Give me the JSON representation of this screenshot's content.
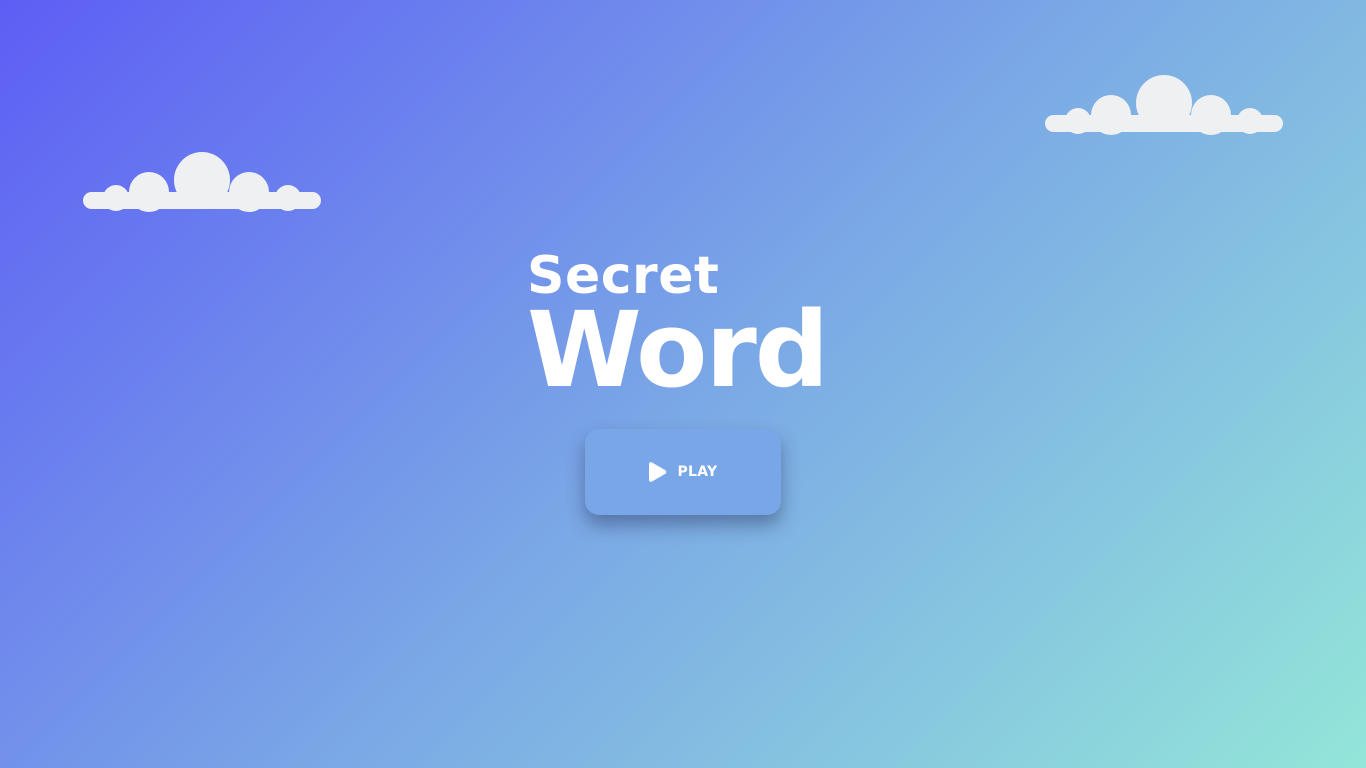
{
  "title": {
    "line1": "Secret",
    "line2": "Word"
  },
  "play_button": {
    "label": "PLAY",
    "icon": "play-icon"
  },
  "decorations": {
    "clouds": [
      "cloud-icon",
      "cloud-icon"
    ]
  },
  "colors": {
    "gradient_start": "#5d5ef5",
    "gradient_mid": "#7aa6e6",
    "gradient_end": "#93e6d9",
    "button": "#78a6e6",
    "cloud": "#eff0f2",
    "text": "#ffffff"
  }
}
